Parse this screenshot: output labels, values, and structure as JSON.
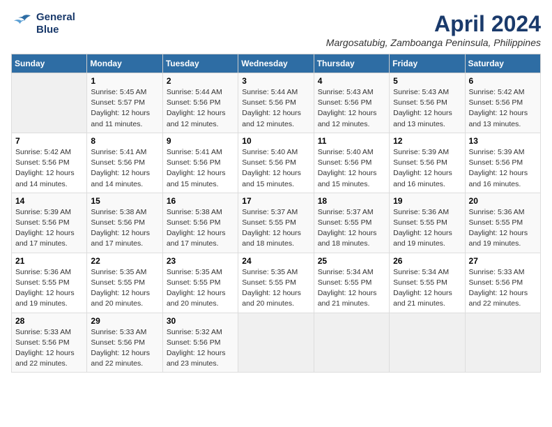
{
  "logo": {
    "line1": "General",
    "line2": "Blue"
  },
  "title": "April 2024",
  "subtitle": "Margosatubig, Zamboanga Peninsula, Philippines",
  "days_header": [
    "Sunday",
    "Monday",
    "Tuesday",
    "Wednesday",
    "Thursday",
    "Friday",
    "Saturday"
  ],
  "weeks": [
    [
      {
        "day": "",
        "info": ""
      },
      {
        "day": "1",
        "info": "Sunrise: 5:45 AM\nSunset: 5:57 PM\nDaylight: 12 hours\nand 11 minutes."
      },
      {
        "day": "2",
        "info": "Sunrise: 5:44 AM\nSunset: 5:56 PM\nDaylight: 12 hours\nand 12 minutes."
      },
      {
        "day": "3",
        "info": "Sunrise: 5:44 AM\nSunset: 5:56 PM\nDaylight: 12 hours\nand 12 minutes."
      },
      {
        "day": "4",
        "info": "Sunrise: 5:43 AM\nSunset: 5:56 PM\nDaylight: 12 hours\nand 12 minutes."
      },
      {
        "day": "5",
        "info": "Sunrise: 5:43 AM\nSunset: 5:56 PM\nDaylight: 12 hours\nand 13 minutes."
      },
      {
        "day": "6",
        "info": "Sunrise: 5:42 AM\nSunset: 5:56 PM\nDaylight: 12 hours\nand 13 minutes."
      }
    ],
    [
      {
        "day": "7",
        "info": "Sunrise: 5:42 AM\nSunset: 5:56 PM\nDaylight: 12 hours\nand 14 minutes."
      },
      {
        "day": "8",
        "info": "Sunrise: 5:41 AM\nSunset: 5:56 PM\nDaylight: 12 hours\nand 14 minutes."
      },
      {
        "day": "9",
        "info": "Sunrise: 5:41 AM\nSunset: 5:56 PM\nDaylight: 12 hours\nand 15 minutes."
      },
      {
        "day": "10",
        "info": "Sunrise: 5:40 AM\nSunset: 5:56 PM\nDaylight: 12 hours\nand 15 minutes."
      },
      {
        "day": "11",
        "info": "Sunrise: 5:40 AM\nSunset: 5:56 PM\nDaylight: 12 hours\nand 15 minutes."
      },
      {
        "day": "12",
        "info": "Sunrise: 5:39 AM\nSunset: 5:56 PM\nDaylight: 12 hours\nand 16 minutes."
      },
      {
        "day": "13",
        "info": "Sunrise: 5:39 AM\nSunset: 5:56 PM\nDaylight: 12 hours\nand 16 minutes."
      }
    ],
    [
      {
        "day": "14",
        "info": "Sunrise: 5:39 AM\nSunset: 5:56 PM\nDaylight: 12 hours\nand 17 minutes."
      },
      {
        "day": "15",
        "info": "Sunrise: 5:38 AM\nSunset: 5:56 PM\nDaylight: 12 hours\nand 17 minutes."
      },
      {
        "day": "16",
        "info": "Sunrise: 5:38 AM\nSunset: 5:56 PM\nDaylight: 12 hours\nand 17 minutes."
      },
      {
        "day": "17",
        "info": "Sunrise: 5:37 AM\nSunset: 5:55 PM\nDaylight: 12 hours\nand 18 minutes."
      },
      {
        "day": "18",
        "info": "Sunrise: 5:37 AM\nSunset: 5:55 PM\nDaylight: 12 hours\nand 18 minutes."
      },
      {
        "day": "19",
        "info": "Sunrise: 5:36 AM\nSunset: 5:55 PM\nDaylight: 12 hours\nand 19 minutes."
      },
      {
        "day": "20",
        "info": "Sunrise: 5:36 AM\nSunset: 5:55 PM\nDaylight: 12 hours\nand 19 minutes."
      }
    ],
    [
      {
        "day": "21",
        "info": "Sunrise: 5:36 AM\nSunset: 5:55 PM\nDaylight: 12 hours\nand 19 minutes."
      },
      {
        "day": "22",
        "info": "Sunrise: 5:35 AM\nSunset: 5:55 PM\nDaylight: 12 hours\nand 20 minutes."
      },
      {
        "day": "23",
        "info": "Sunrise: 5:35 AM\nSunset: 5:55 PM\nDaylight: 12 hours\nand 20 minutes."
      },
      {
        "day": "24",
        "info": "Sunrise: 5:35 AM\nSunset: 5:55 PM\nDaylight: 12 hours\nand 20 minutes."
      },
      {
        "day": "25",
        "info": "Sunrise: 5:34 AM\nSunset: 5:55 PM\nDaylight: 12 hours\nand 21 minutes."
      },
      {
        "day": "26",
        "info": "Sunrise: 5:34 AM\nSunset: 5:55 PM\nDaylight: 12 hours\nand 21 minutes."
      },
      {
        "day": "27",
        "info": "Sunrise: 5:33 AM\nSunset: 5:56 PM\nDaylight: 12 hours\nand 22 minutes."
      }
    ],
    [
      {
        "day": "28",
        "info": "Sunrise: 5:33 AM\nSunset: 5:56 PM\nDaylight: 12 hours\nand 22 minutes."
      },
      {
        "day": "29",
        "info": "Sunrise: 5:33 AM\nSunset: 5:56 PM\nDaylight: 12 hours\nand 22 minutes."
      },
      {
        "day": "30",
        "info": "Sunrise: 5:32 AM\nSunset: 5:56 PM\nDaylight: 12 hours\nand 23 minutes."
      },
      {
        "day": "",
        "info": ""
      },
      {
        "day": "",
        "info": ""
      },
      {
        "day": "",
        "info": ""
      },
      {
        "day": "",
        "info": ""
      }
    ]
  ]
}
